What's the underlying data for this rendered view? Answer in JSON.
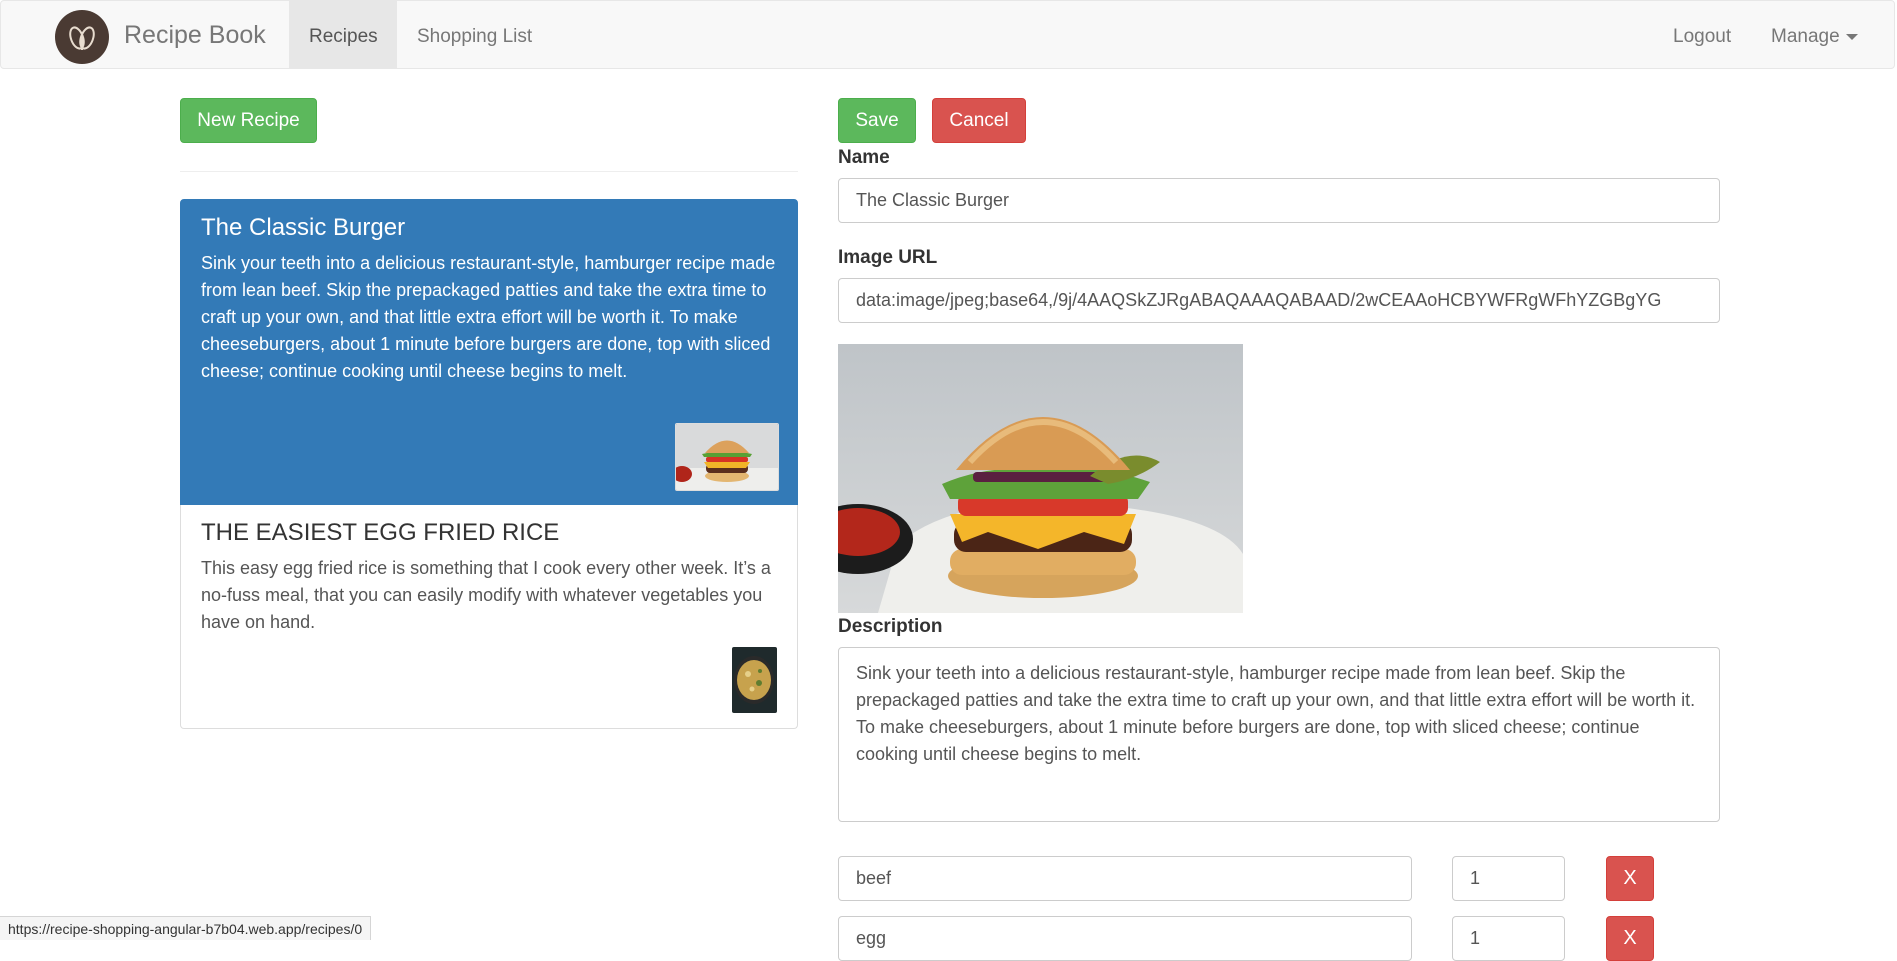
{
  "navbar": {
    "brand": "Recipe Book",
    "tabs": [
      "Recipes",
      "Shopping List"
    ],
    "active_tab": "Recipes",
    "logout": "Logout",
    "manage": "Manage"
  },
  "list": {
    "new_button": "New Recipe",
    "recipes": [
      {
        "title": "The Classic Burger",
        "description": "Sink your teeth into a delicious restaurant-style, hamburger recipe made from lean beef. Skip the prepackaged patties and take the extra time to craft up your own, and that little extra effort will be worth it. To make cheeseburgers, about 1 minute before burgers are done, top with sliced cheese; continue cooking until cheese begins to melt.",
        "active": true
      },
      {
        "title": "THE EASIEST EGG FRIED RICE",
        "description": "This easy egg fried rice is something that I cook every other week. It’s a no-fuss meal, that you can easily modify with whatever vegetables you have on hand.",
        "active": false
      }
    ]
  },
  "form": {
    "save": "Save",
    "cancel": "Cancel",
    "name_label": "Name",
    "name_value": "The Classic Burger",
    "url_label": "Image URL",
    "url_value": "data:image/jpeg;base64,/9j/4AAQSkZJRgABAQAAAQABAAD/2wCEAAoHCBYWFRgWFhYZGBgYG",
    "description_label": "Description",
    "description_value": "Sink your teeth into a delicious restaurant-style, hamburger recipe made from lean beef. Skip the prepackaged patties and take the extra time to craft up your own, and that little extra effort will be worth it. To make cheeseburgers, about 1 minute before burgers are done, top with sliced cheese; continue cooking until cheese begins to melt.",
    "ingredients": [
      {
        "name": "beef",
        "amount": "1",
        "remove": "X"
      },
      {
        "name": "egg",
        "amount": "1",
        "remove": "X"
      }
    ]
  },
  "status_url": "https://recipe-shopping-angular-b7b04.web.app/recipes/0",
  "colors": {
    "primary": "#337ab7",
    "success": "#5cb85c",
    "danger": "#d9534f"
  }
}
